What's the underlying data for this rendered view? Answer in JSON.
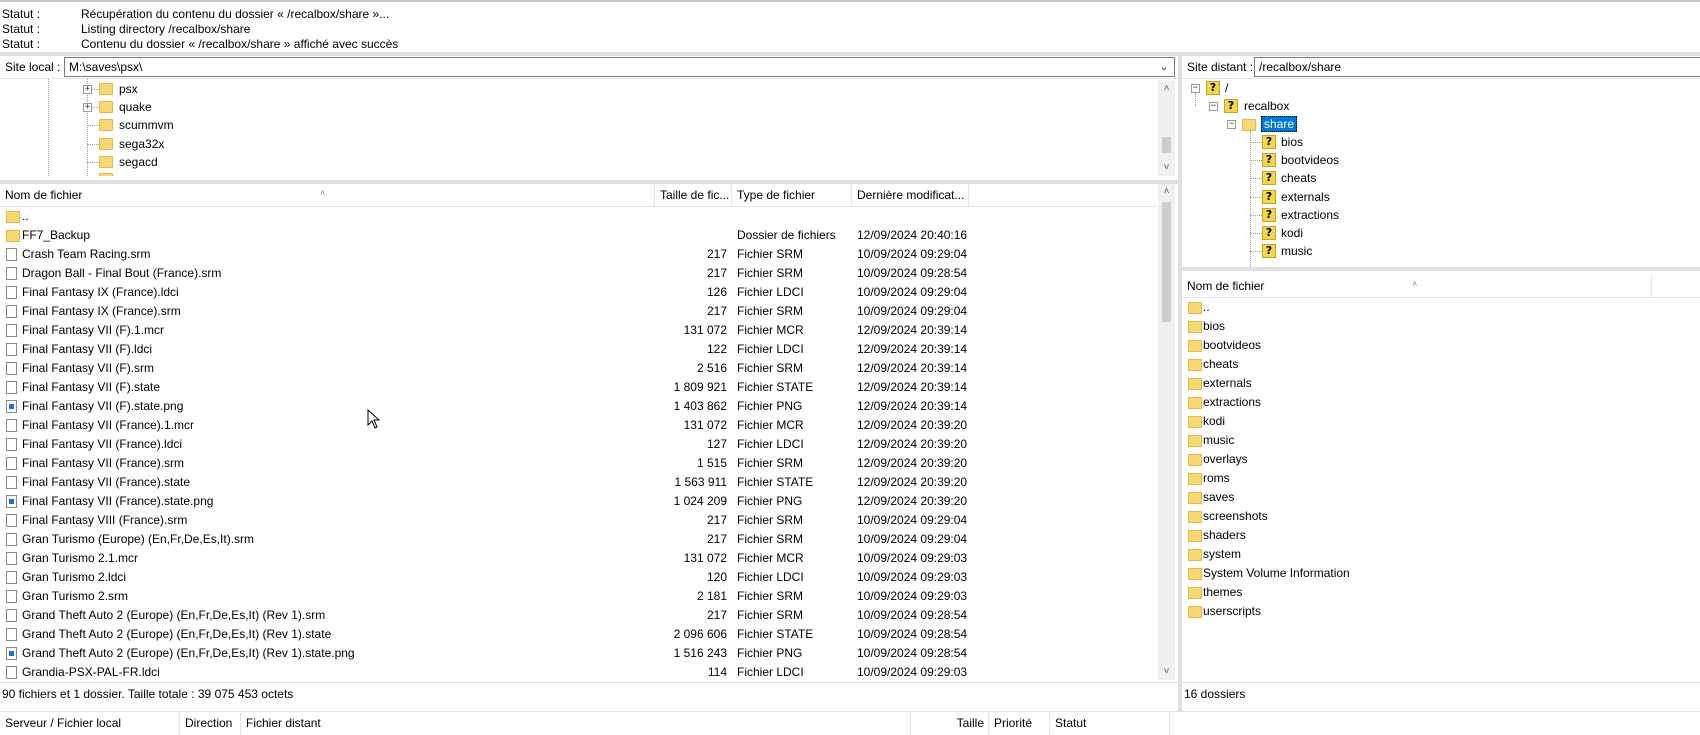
{
  "status_log": [
    {
      "key": "Statut :",
      "value": "Récupération du contenu du dossier « /recalbox/share »..."
    },
    {
      "key": "Statut :",
      "value": "Listing directory /recalbox/share"
    },
    {
      "key": "Statut :",
      "value": "Contenu du dossier « /recalbox/share » affiché avec succès"
    }
  ],
  "local": {
    "label": "Site local :",
    "path": "M:\\saves\\psx\\",
    "tree": [
      {
        "name": "psx",
        "expandable": true
      },
      {
        "name": "quake",
        "expandable": true
      },
      {
        "name": "scummvm",
        "expandable": false
      },
      {
        "name": "sega32x",
        "expandable": false
      },
      {
        "name": "segacd",
        "expandable": false
      }
    ],
    "columns": [
      "Nom de fichier",
      "Taille de fic...",
      "Type de fichier",
      "Dernière modificat..."
    ],
    "files": [
      {
        "name": "..",
        "size": "",
        "type": "",
        "date": "",
        "icon": "folder"
      },
      {
        "name": "FF7_Backup",
        "size": "",
        "type": "Dossier de fichiers",
        "date": "12/09/2024 20:40:16",
        "icon": "folder"
      },
      {
        "name": "Crash Team Racing.srm",
        "size": "217",
        "type": "Fichier SRM",
        "date": "10/09/2024 09:29:04",
        "icon": "file"
      },
      {
        "name": "Dragon Ball - Final Bout (France).srm",
        "size": "217",
        "type": "Fichier SRM",
        "date": "10/09/2024 09:28:54",
        "icon": "file"
      },
      {
        "name": "Final Fantasy IX (France).ldci",
        "size": "126",
        "type": "Fichier LDCI",
        "date": "10/09/2024 09:29:04",
        "icon": "file"
      },
      {
        "name": "Final Fantasy IX (France).srm",
        "size": "217",
        "type": "Fichier SRM",
        "date": "10/09/2024 09:29:04",
        "icon": "file"
      },
      {
        "name": "Final Fantasy VII (F).1.mcr",
        "size": "131 072",
        "type": "Fichier MCR",
        "date": "12/09/2024 20:39:14",
        "icon": "file"
      },
      {
        "name": "Final Fantasy VII (F).ldci",
        "size": "122",
        "type": "Fichier LDCI",
        "date": "12/09/2024 20:39:14",
        "icon": "file"
      },
      {
        "name": "Final Fantasy VII (F).srm",
        "size": "2 516",
        "type": "Fichier SRM",
        "date": "12/09/2024 20:39:14",
        "icon": "file"
      },
      {
        "name": "Final Fantasy VII (F).state",
        "size": "1 809 921",
        "type": "Fichier STATE",
        "date": "12/09/2024 20:39:14",
        "icon": "file"
      },
      {
        "name": "Final Fantasy VII (F).state.png",
        "size": "1 403 862",
        "type": "Fichier PNG",
        "date": "12/09/2024 20:39:14",
        "icon": "png"
      },
      {
        "name": "Final Fantasy VII (France).1.mcr",
        "size": "131 072",
        "type": "Fichier MCR",
        "date": "12/09/2024 20:39:20",
        "icon": "file"
      },
      {
        "name": "Final Fantasy VII (France).ldci",
        "size": "127",
        "type": "Fichier LDCI",
        "date": "12/09/2024 20:39:20",
        "icon": "file"
      },
      {
        "name": "Final Fantasy VII (France).srm",
        "size": "1 515",
        "type": "Fichier SRM",
        "date": "12/09/2024 20:39:20",
        "icon": "file"
      },
      {
        "name": "Final Fantasy VII (France).state",
        "size": "1 563 911",
        "type": "Fichier STATE",
        "date": "12/09/2024 20:39:20",
        "icon": "file"
      },
      {
        "name": "Final Fantasy VII (France).state.png",
        "size": "1 024 209",
        "type": "Fichier PNG",
        "date": "12/09/2024 20:39:20",
        "icon": "png"
      },
      {
        "name": "Final Fantasy VIII (France).srm",
        "size": "217",
        "type": "Fichier SRM",
        "date": "10/09/2024 09:29:04",
        "icon": "file"
      },
      {
        "name": "Gran Turismo (Europe) (En,Fr,De,Es,It).srm",
        "size": "217",
        "type": "Fichier SRM",
        "date": "10/09/2024 09:29:04",
        "icon": "file"
      },
      {
        "name": "Gran Turismo 2.1.mcr",
        "size": "131 072",
        "type": "Fichier MCR",
        "date": "10/09/2024 09:29:03",
        "icon": "file"
      },
      {
        "name": "Gran Turismo 2.ldci",
        "size": "120",
        "type": "Fichier LDCI",
        "date": "10/09/2024 09:29:03",
        "icon": "file"
      },
      {
        "name": "Gran Turismo 2.srm",
        "size": "2 181",
        "type": "Fichier SRM",
        "date": "10/09/2024 09:29:03",
        "icon": "file"
      },
      {
        "name": "Grand Theft Auto 2 (Europe) (En,Fr,De,Es,It) (Rev 1).srm",
        "size": "217",
        "type": "Fichier SRM",
        "date": "10/09/2024 09:28:54",
        "icon": "file"
      },
      {
        "name": "Grand Theft Auto 2 (Europe) (En,Fr,De,Es,It) (Rev 1).state",
        "size": "2 096 606",
        "type": "Fichier STATE",
        "date": "10/09/2024 09:28:54",
        "icon": "file"
      },
      {
        "name": "Grand Theft Auto 2 (Europe) (En,Fr,De,Es,It) (Rev 1).state.png",
        "size": "1 516 243",
        "type": "Fichier PNG",
        "date": "10/09/2024 09:28:54",
        "icon": "png"
      },
      {
        "name": "Grandia-PSX-PAL-FR.ldci",
        "size": "114",
        "type": "Fichier LDCI",
        "date": "10/09/2024 09:29:03",
        "icon": "file"
      }
    ],
    "footer": "90 fichiers et 1 dossier. Taille totale : 39 075 453 octets"
  },
  "remote": {
    "label": "Site distant :",
    "path": "/recalbox/share",
    "tree": {
      "root": "/",
      "recalbox": "recalbox",
      "share": "share",
      "children": [
        "bios",
        "bootvideos",
        "cheats",
        "externals",
        "extractions",
        "kodi",
        "music"
      ]
    },
    "column": "Nom de fichier",
    "files": [
      "..",
      "bios",
      "bootvideos",
      "cheats",
      "externals",
      "extractions",
      "kodi",
      "music",
      "overlays",
      "roms",
      "saves",
      "screenshots",
      "shaders",
      "system",
      "System Volume Information",
      "themes",
      "userscripts"
    ],
    "footer": "16 dossiers"
  },
  "queue": {
    "columns": [
      "Serveur / Fichier local",
      "Direction",
      "Fichier distant",
      "Taille",
      "Priorité",
      "Statut"
    ]
  },
  "colors": {
    "folder": "#f8d775",
    "selection": "#0078d7"
  }
}
